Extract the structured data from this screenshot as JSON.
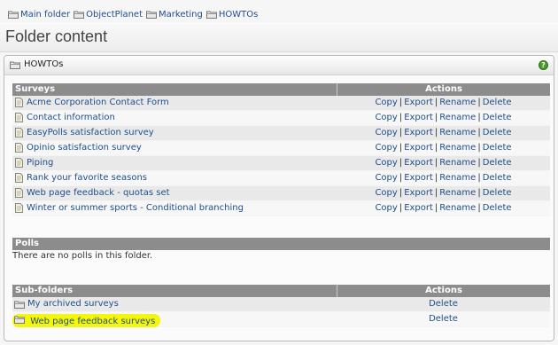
{
  "breadcrumb": [
    "Main folder",
    "ObjectPlanet",
    "Marketing",
    "HOWTOs"
  ],
  "page_title": "Folder content",
  "panel": {
    "title": "HOWTOs",
    "help_label": "?"
  },
  "surveys": {
    "header": "Surveys",
    "actions_header": "Actions",
    "items": [
      "Acme Corporation Contact Form",
      "Contact information",
      "EasyPolls satisfaction survey",
      "Opinio satisfaction survey",
      "Piping",
      "Rank your favorite seasons",
      "Web page feedback - quotas set",
      "Winter or summer sports - Conditional branching"
    ],
    "actions": {
      "copy": "Copy",
      "export": "Export",
      "rename": "Rename",
      "delete": "Delete",
      "separator": "|"
    }
  },
  "polls": {
    "header": "Polls",
    "empty_text": "There are no polls in this folder."
  },
  "subfolders": {
    "header": "Sub-folders",
    "actions_header": "Actions",
    "items": [
      "My archived surveys",
      "Web page feedback surveys"
    ],
    "delete_label": "Delete"
  },
  "colors": {
    "link": "#1f4e8c",
    "section_header": "#8c8c8c",
    "highlight": "#f4f70a"
  },
  "icons": {
    "crumb": "folder-icon",
    "survey": "survey-document-icon",
    "folder": "folder-icon",
    "help": "help-icon"
  }
}
